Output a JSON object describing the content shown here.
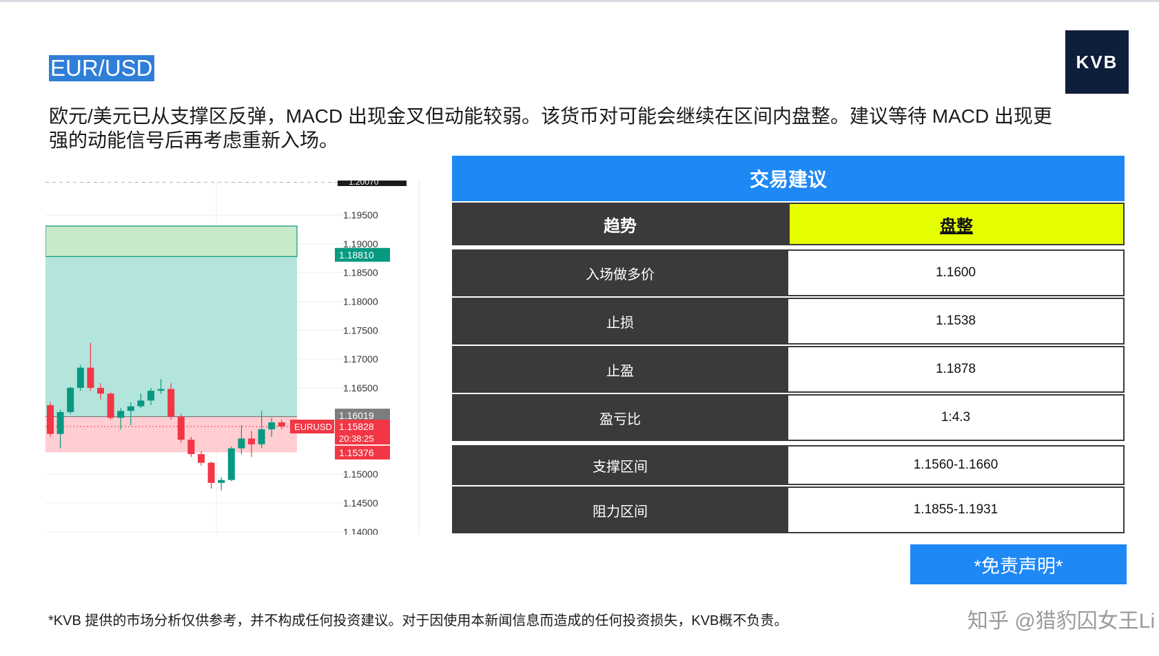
{
  "brand": {
    "logo_text": "KVB"
  },
  "header": {
    "pair": "EUR/USD",
    "description": "欧元/美元已从支撑区反弹，MACD 出现金叉但动能较弱。该货币对可能会继续在区间内盘整。建议等待 MACD 出现更强的动能信号后再考虑重新入场。"
  },
  "colors": {
    "accent": "#1e88f5",
    "dark_cell": "#3a3a3a",
    "trend_highlight": "#e6ff00",
    "bull_candle": "#089981",
    "bear_candle": "#f23645",
    "logo_bg": "#0f1e3a"
  },
  "chart_data": {
    "type": "candlestick",
    "symbol": "EURUSD",
    "y_ticks": [
      "1.19500",
      "1.19000",
      "1.18500",
      "1.18000",
      "1.17500",
      "1.17000",
      "1.16500",
      "1.15000",
      "1.14500",
      "1.14000"
    ],
    "ylim": [
      1.1395,
      1.201
    ],
    "top_label": "1.20070",
    "price_labels": [
      {
        "value": 1.1881,
        "text": "1.18810",
        "color": "#089981"
      },
      {
        "value": 1.16019,
        "text": "1.16019",
        "color": "#7d7d7d"
      },
      {
        "value": 1.15828,
        "text": "1.15828",
        "color": "#f23645"
      },
      {
        "value": 1.15376,
        "text": "1.15376",
        "color": "#f23645"
      }
    ],
    "countdown": "20:38:25",
    "symbol_tag": "EURUSD",
    "zones": [
      {
        "name": "target",
        "from": 1.1878,
        "to": 1.1931,
        "color": "#c8eac9"
      },
      {
        "name": "reward",
        "from": 1.16,
        "to": 1.1878,
        "color": "#b3e5dc"
      },
      {
        "name": "risk",
        "from": 1.1538,
        "to": 1.16,
        "color": "#ffcdd2"
      }
    ],
    "candles": [
      {
        "o": 1.162,
        "h": 1.1625,
        "c": 1.157,
        "l": 1.1565
      },
      {
        "o": 1.157,
        "h": 1.1612,
        "c": 1.1608,
        "l": 1.1545
      },
      {
        "o": 1.1608,
        "h": 1.1652,
        "c": 1.165,
        "l": 1.1605
      },
      {
        "o": 1.165,
        "h": 1.169,
        "c": 1.1685,
        "l": 1.1645
      },
      {
        "o": 1.1685,
        "h": 1.1728,
        "c": 1.165,
        "l": 1.1645
      },
      {
        "o": 1.165,
        "h": 1.1658,
        "c": 1.164,
        "l": 1.163
      },
      {
        "o": 1.164,
        "h": 1.1642,
        "c": 1.1598,
        "l": 1.1595
      },
      {
        "o": 1.1598,
        "h": 1.1615,
        "c": 1.161,
        "l": 1.1578
      },
      {
        "o": 1.161,
        "h": 1.1625,
        "c": 1.1618,
        "l": 1.1585
      },
      {
        "o": 1.1618,
        "h": 1.164,
        "c": 1.1628,
        "l": 1.1615
      },
      {
        "o": 1.1628,
        "h": 1.165,
        "c": 1.1645,
        "l": 1.162
      },
      {
        "o": 1.1645,
        "h": 1.1665,
        "c": 1.1648,
        "l": 1.164
      },
      {
        "o": 1.1648,
        "h": 1.1658,
        "c": 1.16,
        "l": 1.1595
      },
      {
        "o": 1.16,
        "h": 1.1605,
        "c": 1.156,
        "l": 1.1555
      },
      {
        "o": 1.156,
        "h": 1.1565,
        "c": 1.1535,
        "l": 1.153
      },
      {
        "o": 1.1535,
        "h": 1.154,
        "c": 1.152,
        "l": 1.1515
      },
      {
        "o": 1.152,
        "h": 1.1522,
        "c": 1.1485,
        "l": 1.1475
      },
      {
        "o": 1.1485,
        "h": 1.1495,
        "c": 1.149,
        "l": 1.1472
      },
      {
        "o": 1.149,
        "h": 1.1548,
        "c": 1.1545,
        "l": 1.1488
      },
      {
        "o": 1.1545,
        "h": 1.1585,
        "c": 1.1562,
        "l": 1.1535
      },
      {
        "o": 1.1562,
        "h": 1.1575,
        "c": 1.1552,
        "l": 1.153
      },
      {
        "o": 1.1552,
        "h": 1.161,
        "c": 1.1578,
        "l": 1.1545
      },
      {
        "o": 1.1578,
        "h": 1.1598,
        "c": 1.159,
        "l": 1.1565
      },
      {
        "o": 1.159,
        "h": 1.1595,
        "c": 1.1583,
        "l": 1.1578
      }
    ]
  },
  "recommendation": {
    "title": "交易建议",
    "trend_label": "趋势",
    "trend_value": "盘整",
    "rows": [
      {
        "label": "入场做多价",
        "value": "1.1600"
      },
      {
        "label": "止损",
        "value": "1.1538"
      },
      {
        "label": "止盈",
        "value": "1.1878"
      },
      {
        "label": "盈亏比",
        "value": "1:4.3"
      },
      {
        "label": "支撑区间",
        "value": "1.1560-1.1660"
      },
      {
        "label": "阻力区间",
        "value": "1.1855-1.1931"
      }
    ]
  },
  "disclaimer_button": "*免责声明*",
  "footnote": "*KVB 提供的市场分析仅供参考，并不构成任何投资建议。对于因使用本新闻信息而造成的任何投资损失，KVB概不负责。",
  "watermark": "知乎 @猎豹囚女王Li"
}
